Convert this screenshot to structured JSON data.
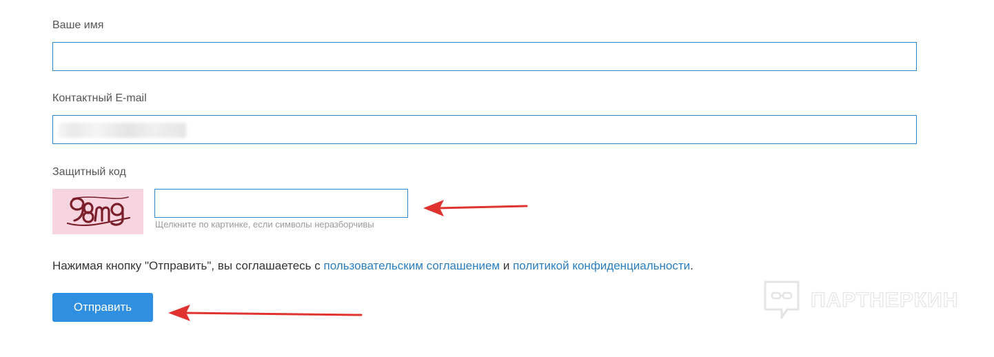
{
  "form": {
    "name_label": "Ваше имя",
    "name_value": "",
    "email_label": "Контактный E-mail",
    "email_value": "",
    "captcha_label": "Защитный код",
    "captcha_image_text": "98mg",
    "captcha_value": "",
    "captcha_hint": "Щелкните по картинке, если символы неразборчивы",
    "agreement": {
      "prefix": "Нажимая кнопку \"Отправить\", вы соглашаетесь с ",
      "terms_link": "пользовательским соглашением",
      "conjunction": " и ",
      "privacy_link": "политикой конфиденциальности",
      "suffix": "."
    },
    "submit_label": "Отправить"
  },
  "watermark": {
    "text": "ПАРТНЕРКИН"
  },
  "colors": {
    "input_border": "#2a85c9",
    "button_bg": "#2f8fe0",
    "link": "#2a7ec0",
    "captcha_bg": "#f6d5e0",
    "captcha_ink": "#7a1f2a",
    "annotation_arrow": "#e0332f"
  },
  "icons": {
    "annotation": "red-arrow-icon",
    "watermark": "chat-bubble-logo-icon"
  }
}
